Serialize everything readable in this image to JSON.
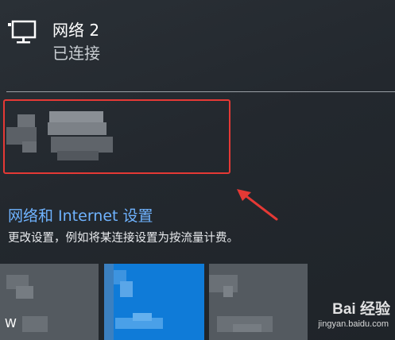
{
  "network": {
    "icon": "ethernet-monitor-icon",
    "name": "网络 2",
    "status": "已连接"
  },
  "settings": {
    "link_label": "网络和 Internet 设置",
    "description": "更改设置，例如将某连接设置为按流量计费。"
  },
  "tiles": [
    {
      "label": "W"
    },
    {
      "label": ""
    },
    {
      "label": ""
    }
  ],
  "watermark": {
    "logo_text": "Bai 经验",
    "url": "jingyan.baidu.com"
  },
  "colors": {
    "background": "#262b31",
    "link": "#6fb3ff",
    "highlight_border": "#e53935",
    "active_tile": "#0f7bd8",
    "inactive_tile": "#545a60"
  }
}
